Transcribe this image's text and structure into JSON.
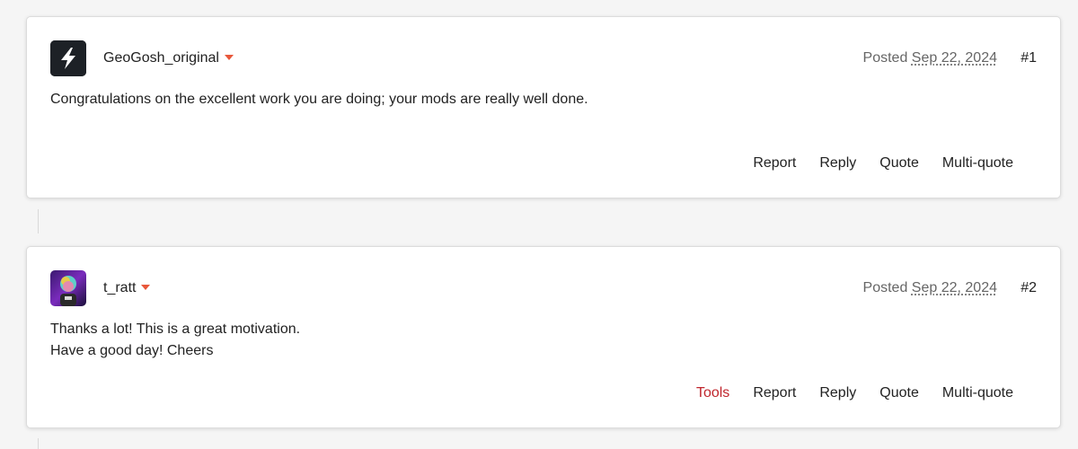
{
  "posts": [
    {
      "author": "GeoGosh_original",
      "avatar_icon": "lightning-bolt-icon",
      "posted_label": "Posted",
      "date": "Sep 22, 2024",
      "number": "#1",
      "content": [
        "Congratulations on the excellent work you are doing; your mods are really well done."
      ],
      "actions": [
        "Report",
        "Reply",
        "Quote",
        "Multi-quote"
      ]
    },
    {
      "author": "t_ratt",
      "avatar_icon": "user-avatar-image",
      "posted_label": "Posted",
      "date": "Sep 22, 2024",
      "number": "#2",
      "content": [
        "Thanks a lot! This is a great motivation.",
        "Have a good day! Cheers"
      ],
      "tools_label": "Tools",
      "actions": [
        "Report",
        "Reply",
        "Quote",
        "Multi-quote"
      ]
    }
  ],
  "colors": {
    "accent_caret": "#e8573a",
    "tools": "#c0262d"
  }
}
